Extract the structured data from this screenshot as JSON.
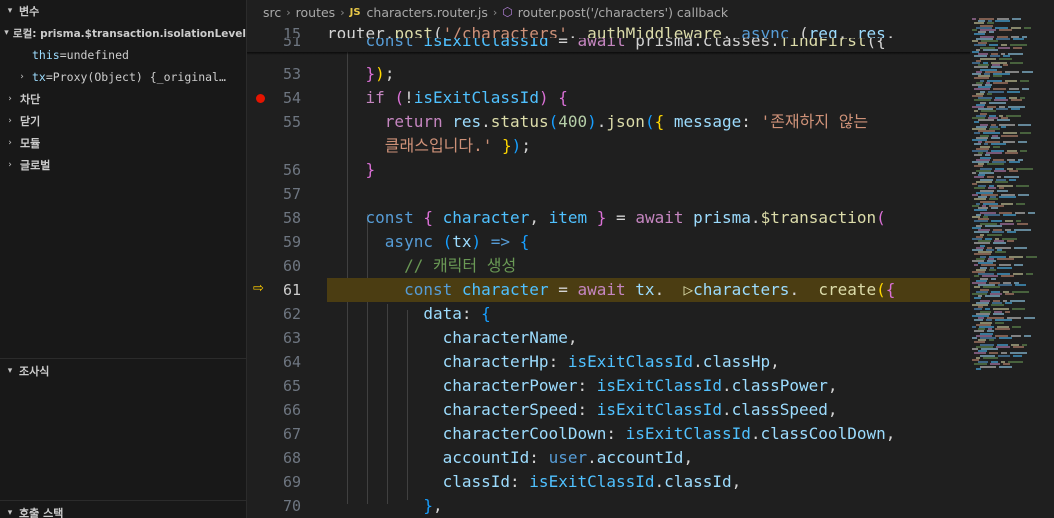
{
  "sidebar": {
    "variables_header": "변수",
    "local_scope": "로컬: prisma.$transaction.isolationLevel",
    "this_var": {
      "name": "this",
      "value": "undefined"
    },
    "tx_var": {
      "name": "tx",
      "value": "Proxy(Object) {_original…"
    },
    "scopes": [
      "차단",
      "닫기",
      "모듈",
      "글로벌"
    ],
    "watch_header": "조사식",
    "callstack_header": "호출 스택"
  },
  "breadcrumb": {
    "folder1": "src",
    "folder2": "routes",
    "file_badge": "JS",
    "file": "characters.router.js",
    "symbol": "router.post('/characters') callback"
  },
  "editor": {
    "active_line": 61,
    "breakpoint_line": 54,
    "sticky": [
      {
        "ln": "15",
        "tokens": [
          [
            "tx",
            "router."
          ],
          [
            "fn",
            "post"
          ],
          [
            "tx",
            "("
          ],
          [
            "str",
            "'/characters'"
          ],
          [
            "tx",
            ", "
          ],
          [
            "fn",
            "authMiddleware"
          ],
          [
            "tx",
            ", "
          ],
          [
            "kwd",
            "async"
          ],
          [
            "tx",
            " ("
          ],
          [
            "vr",
            "req"
          ],
          [
            "tx",
            ", "
          ],
          [
            "vr",
            "res"
          ],
          [
            "tx",
            ", "
          ]
        ]
      },
      {
        "ln": "51",
        "tokens": [
          [
            "tx",
            "    "
          ],
          [
            "kwd",
            "const"
          ],
          [
            "tx",
            " "
          ],
          [
            "cv",
            "isExitClassId"
          ],
          [
            "tx",
            " = "
          ],
          [
            "kw",
            "await"
          ],
          [
            "tx",
            " prisma.classes."
          ],
          [
            "fn",
            "findFirst"
          ],
          [
            "tx",
            "({"
          ]
        ]
      }
    ],
    "lines": [
      {
        "ln": "53",
        "tokens": [
          [
            "tx",
            "    "
          ],
          [
            "br2",
            "}"
          ],
          [
            "br1",
            ")"
          ],
          [
            "tx",
            ";"
          ]
        ]
      },
      {
        "ln": "54",
        "tokens": [
          [
            "tx",
            "    "
          ],
          [
            "kw",
            "if"
          ],
          [
            "tx",
            " "
          ],
          [
            "br2",
            "("
          ],
          [
            "tx",
            "!"
          ],
          [
            "cv",
            "isExitClassId"
          ],
          [
            "br2",
            ")"
          ],
          [
            "tx",
            " "
          ],
          [
            "br2",
            "{"
          ]
        ]
      },
      {
        "ln": "55",
        "tokens": [
          [
            "tx",
            "      "
          ],
          [
            "kw",
            "return"
          ],
          [
            "tx",
            " "
          ],
          [
            "vr",
            "res"
          ],
          [
            "tx",
            "."
          ],
          [
            "fn",
            "status"
          ],
          [
            "br3",
            "("
          ],
          [
            "num",
            "400"
          ],
          [
            "br3",
            ")"
          ],
          [
            "tx",
            "."
          ],
          [
            "fn",
            "json"
          ],
          [
            "br3",
            "("
          ],
          [
            "br1",
            "{"
          ],
          [
            "tx",
            " "
          ],
          [
            "vr",
            "message"
          ],
          [
            "tx",
            ": "
          ],
          [
            "str",
            "'존재하지 않는"
          ]
        ]
      },
      {
        "ln": "",
        "tokens": [
          [
            "tx",
            "      "
          ],
          [
            "str",
            "클래스입니다.'"
          ],
          [
            "tx",
            " "
          ],
          [
            "br1",
            "}"
          ],
          [
            "br3",
            ")"
          ],
          [
            "tx",
            ";"
          ]
        ]
      },
      {
        "ln": "56",
        "tokens": [
          [
            "tx",
            "    "
          ],
          [
            "br2",
            "}"
          ]
        ]
      },
      {
        "ln": "57",
        "tokens": []
      },
      {
        "ln": "58",
        "tokens": [
          [
            "tx",
            "    "
          ],
          [
            "kwd",
            "const"
          ],
          [
            "tx",
            " "
          ],
          [
            "br2",
            "{"
          ],
          [
            "tx",
            " "
          ],
          [
            "cv",
            "character"
          ],
          [
            "tx",
            ", "
          ],
          [
            "cv",
            "item"
          ],
          [
            "tx",
            " "
          ],
          [
            "br2",
            "}"
          ],
          [
            "tx",
            " = "
          ],
          [
            "kw",
            "await"
          ],
          [
            "tx",
            " "
          ],
          [
            "vr",
            "prisma"
          ],
          [
            "tx",
            "."
          ],
          [
            "fn",
            "$transaction"
          ],
          [
            "br2",
            "("
          ]
        ]
      },
      {
        "ln": "59",
        "tokens": [
          [
            "tx",
            "      "
          ],
          [
            "kwd",
            "async"
          ],
          [
            "tx",
            " "
          ],
          [
            "br3",
            "("
          ],
          [
            "vr",
            "tx"
          ],
          [
            "br3",
            ")"
          ],
          [
            "tx",
            " "
          ],
          [
            "kwd",
            "=>"
          ],
          [
            "tx",
            " "
          ],
          [
            "br3",
            "{"
          ]
        ]
      },
      {
        "ln": "60",
        "tokens": [
          [
            "tx",
            "        "
          ],
          [
            "cm",
            "// 캐릭터 생성"
          ]
        ]
      },
      {
        "ln": "61",
        "tokens": [
          [
            "tx",
            "        "
          ],
          [
            "kwd",
            "const"
          ],
          [
            "tx",
            " "
          ],
          [
            "cv",
            "character"
          ],
          [
            "tx",
            " = "
          ],
          [
            "kw",
            "await"
          ],
          [
            "tx",
            " "
          ],
          [
            "vr",
            "tx"
          ],
          [
            "tx",
            ".  "
          ],
          [
            "fn",
            "▷"
          ],
          [
            "vr",
            "characters"
          ],
          [
            "tx",
            ".  "
          ],
          [
            "fn",
            "create"
          ],
          [
            "br1",
            "("
          ],
          [
            "br2",
            "{"
          ]
        ]
      },
      {
        "ln": "62",
        "tokens": [
          [
            "tx",
            "          "
          ],
          [
            "vr",
            "data"
          ],
          [
            "tx",
            ": "
          ],
          [
            "br3",
            "{"
          ]
        ]
      },
      {
        "ln": "63",
        "tokens": [
          [
            "tx",
            "            "
          ],
          [
            "vr",
            "characterName"
          ],
          [
            "tx",
            ","
          ]
        ]
      },
      {
        "ln": "64",
        "tokens": [
          [
            "tx",
            "            "
          ],
          [
            "vr",
            "characterHp"
          ],
          [
            "tx",
            ": "
          ],
          [
            "cv",
            "isExitClassId"
          ],
          [
            "tx",
            "."
          ],
          [
            "vr",
            "classHp"
          ],
          [
            "tx",
            ","
          ]
        ]
      },
      {
        "ln": "65",
        "tokens": [
          [
            "tx",
            "            "
          ],
          [
            "vr",
            "characterPower"
          ],
          [
            "tx",
            ": "
          ],
          [
            "cv",
            "isExitClassId"
          ],
          [
            "tx",
            "."
          ],
          [
            "vr",
            "classPower"
          ],
          [
            "tx",
            ","
          ]
        ]
      },
      {
        "ln": "66",
        "tokens": [
          [
            "tx",
            "            "
          ],
          [
            "vr",
            "characterSpeed"
          ],
          [
            "tx",
            ": "
          ],
          [
            "cv",
            "isExitClassId"
          ],
          [
            "tx",
            "."
          ],
          [
            "vr",
            "classSpeed"
          ],
          [
            "tx",
            ","
          ]
        ]
      },
      {
        "ln": "67",
        "tokens": [
          [
            "tx",
            "            "
          ],
          [
            "vr",
            "characterCoolDown"
          ],
          [
            "tx",
            ": "
          ],
          [
            "cv",
            "isExitClassId"
          ],
          [
            "tx",
            "."
          ],
          [
            "vr",
            "classCoolDown"
          ],
          [
            "tx",
            ","
          ]
        ]
      },
      {
        "ln": "68",
        "tokens": [
          [
            "tx",
            "            "
          ],
          [
            "vr",
            "accountId"
          ],
          [
            "tx",
            ": "
          ],
          [
            "kwd",
            "user"
          ],
          [
            "tx",
            "."
          ],
          [
            "vr",
            "accountId"
          ],
          [
            "tx",
            ","
          ]
        ]
      },
      {
        "ln": "69",
        "tokens": [
          [
            "tx",
            "            "
          ],
          [
            "vr",
            "classId"
          ],
          [
            "tx",
            ": "
          ],
          [
            "cv",
            "isExitClassId"
          ],
          [
            "tx",
            "."
          ],
          [
            "vr",
            "classId"
          ],
          [
            "tx",
            ","
          ]
        ]
      },
      {
        "ln": "70",
        "tokens": [
          [
            "tx",
            "          "
          ],
          [
            "br3",
            "}"
          ],
          [
            "tx",
            ","
          ]
        ]
      }
    ]
  },
  "colors": {
    "breakpoint": "#e51400",
    "debug_current": "#ffcc00",
    "current_line_bg": "#4b3d12"
  }
}
